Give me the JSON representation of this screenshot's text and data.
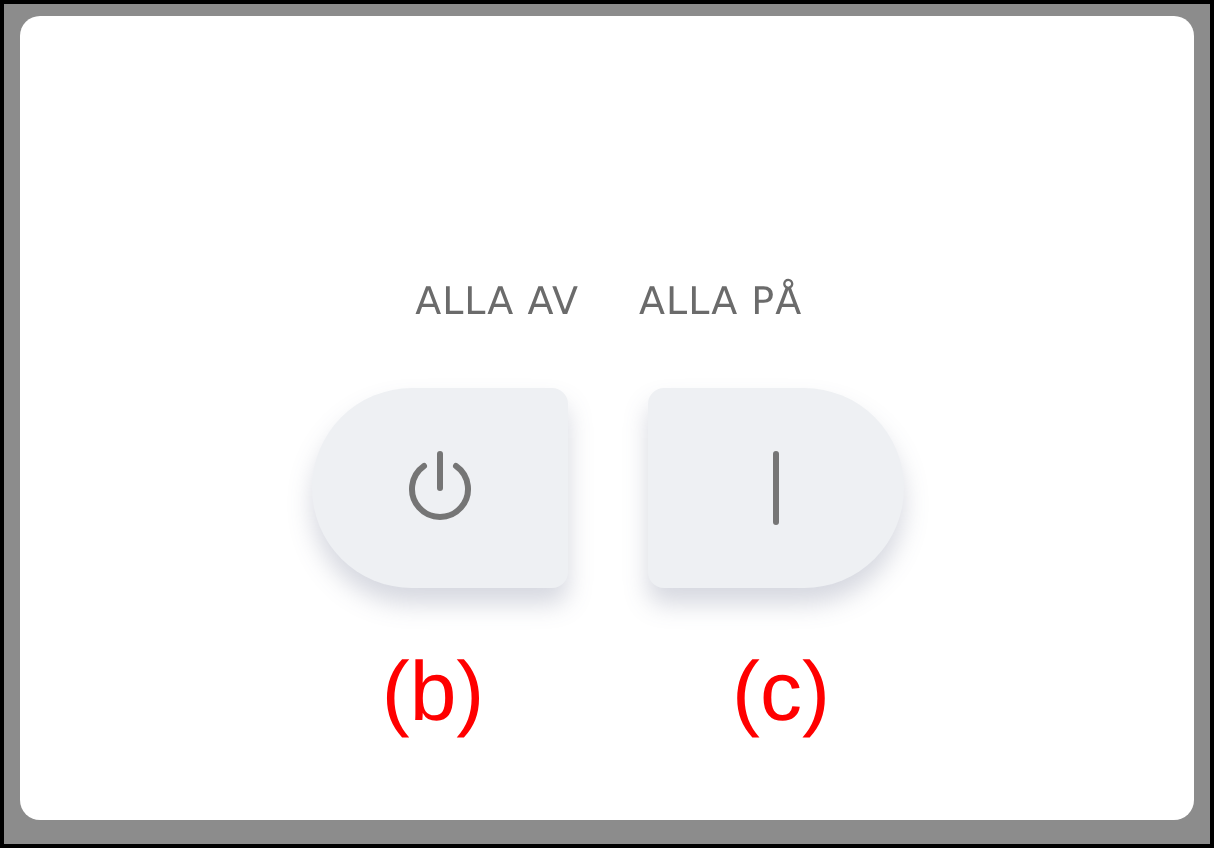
{
  "switches": [
    {
      "label": "ALLA AV",
      "kind": "off",
      "annotation": "(b)"
    },
    {
      "label": "ALLA PÅ",
      "kind": "on",
      "annotation": "(c)"
    }
  ]
}
